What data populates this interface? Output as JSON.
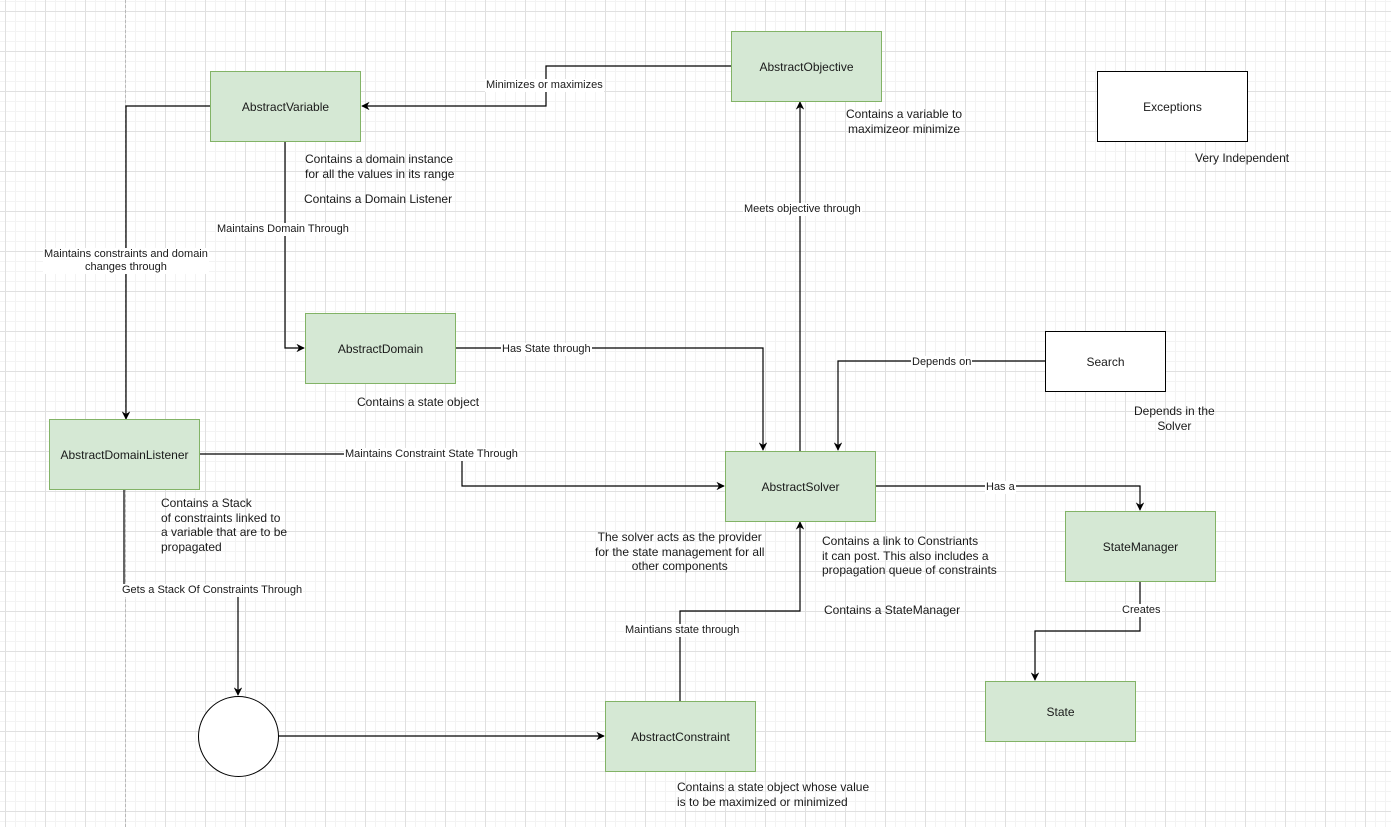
{
  "nodes": {
    "abstract_variable": "AbstractVariable",
    "abstract_objective": "AbstractObjective",
    "exceptions": "Exceptions",
    "abstract_domain": "AbstractDomain",
    "search": "Search",
    "abstract_domain_listener": "AbstractDomainListener",
    "abstract_solver": "AbstractSolver",
    "state_manager": "StateManager",
    "state": "State",
    "abstract_constraint": "AbstractConstraint",
    "stack_circle": ""
  },
  "edge_labels": {
    "minimizes_or_maximizes": "Minimizes or maximizes",
    "maintains_domain_through": "Maintains Domain Through",
    "maintains_constraints_domain_changes": "Maintains constraints and domain\nchanges through",
    "has_state_through": "Has State through",
    "meets_objective_through": "Meets objective through",
    "depends_on": "Depends on",
    "maintains_constraint_state_through": "Maintains Constraint State Through",
    "has_a": "Has a",
    "creates": "Creates",
    "gets_stack_of_constraints_through": "Gets a Stack Of Constraints Through",
    "maintians_state_through": "Maintians state through"
  },
  "notes": {
    "variable_domain_instance": "Contains a domain instance\nfor all the values in its range",
    "variable_domain_listener": "Contains a Domain Listener",
    "objective_variable": "Contains a variable to\nmaximizeor minimize",
    "exceptions_independent": "Very Independent",
    "domain_state_object": "Contains a state object",
    "search_depends": "Depends in the\nSolver",
    "listener_stack": "Contains a Stack\nof constraints linked to\na variable that are to be\npropagated",
    "solver_provider": "The solver acts as the provider\nfor the state management for all\nother components",
    "solver_constraints_link": "Contains a link to Constriants\nit can post. This also includes a\npropagation queue of constraints",
    "solver_state_manager": "Contains a StateManager",
    "constraint_state_object": "Contains a state object whose value\nis to be maximized or minimized"
  },
  "colors": {
    "node_fill": "#d5e8d4",
    "node_border": "#82b366",
    "edge": "#000000"
  }
}
